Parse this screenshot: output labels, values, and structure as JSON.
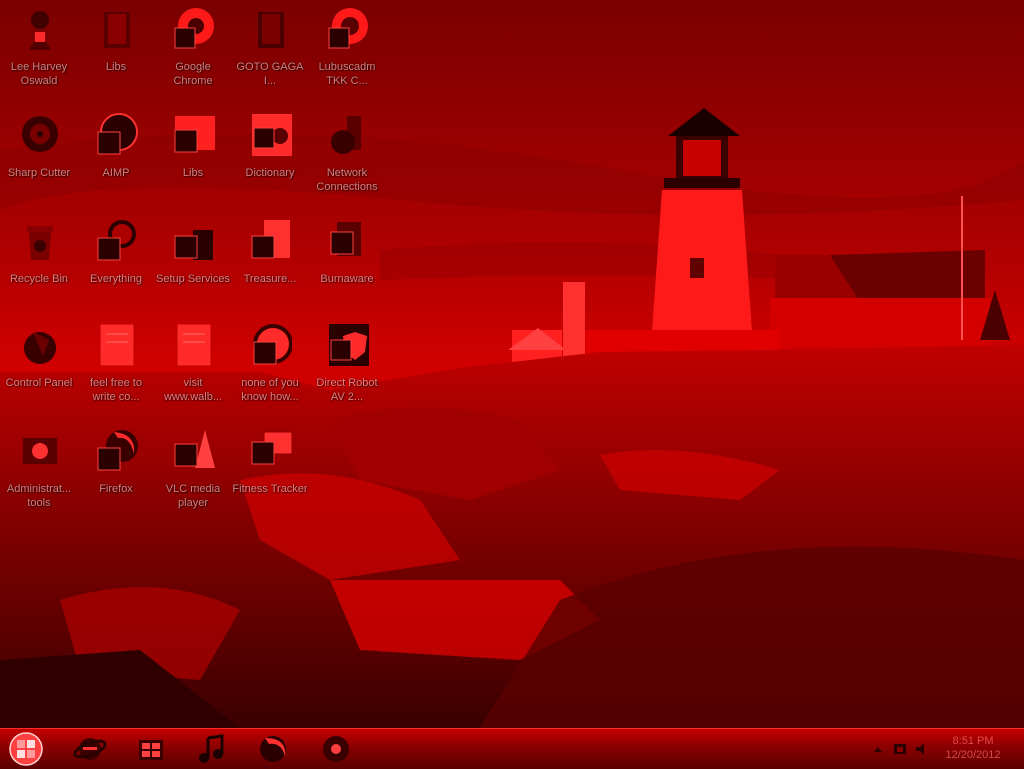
{
  "desktop": {
    "icons": [
      {
        "label": "Lee Harvey Oswald",
        "icon": "person-icon"
      },
      {
        "label": "Libs",
        "icon": "folder-icon"
      },
      {
        "label": "Google Chrome",
        "icon": "chrome-icon"
      },
      {
        "label": "GOTO GAGA I...",
        "icon": "folder-icon"
      },
      {
        "label": "Lubuscadm TKK C...",
        "icon": "shortcut-icon"
      },
      {
        "label": "Sharp Cutter",
        "icon": "disc-icon"
      },
      {
        "label": "AIMP",
        "icon": "aimp-icon"
      },
      {
        "label": "Libs",
        "icon": "media-icon"
      },
      {
        "label": "Dictionary",
        "icon": "dictionary-icon"
      },
      {
        "label": "Network Connections",
        "icon": "network-icon"
      },
      {
        "label": "Recycle Bin",
        "icon": "recycle-bin-icon"
      },
      {
        "label": "Everything",
        "icon": "search-icon"
      },
      {
        "label": "Setup Services",
        "icon": "setup-icon"
      },
      {
        "label": "Treasure...",
        "icon": "document-icon"
      },
      {
        "label": "Burnaware",
        "icon": "burn-icon"
      },
      {
        "label": "Control Panel",
        "icon": "control-panel-icon"
      },
      {
        "label": "feel free to write co...",
        "icon": "text-file-icon"
      },
      {
        "label": "visit www.walb...",
        "icon": "text-file-icon"
      },
      {
        "label": "none of you know how...",
        "icon": "text-file-icon"
      },
      {
        "label": "Direct Robot AV 2...",
        "icon": "shield-icon"
      },
      {
        "label": "Administrat... tools",
        "icon": "tools-icon"
      },
      {
        "label": "Firefox",
        "icon": "firefox-icon"
      },
      {
        "label": "VLC media player",
        "icon": "vlc-icon"
      },
      {
        "label": "Fitness Tracker",
        "icon": "app-icon"
      }
    ]
  },
  "taskbar": {
    "start": {
      "icon": "windows-orb-icon"
    },
    "pinned": [
      {
        "name": "Internet Explorer",
        "icon": "internet-explorer-icon"
      },
      {
        "name": "Windows Media Center",
        "icon": "media-center-icon"
      },
      {
        "name": "Music",
        "icon": "music-note-icon"
      },
      {
        "name": "Firefox",
        "icon": "firefox-icon"
      },
      {
        "name": "Google Chrome",
        "icon": "chrome-icon"
      }
    ],
    "tray": {
      "icons": [
        "show-hidden-icons-icon",
        "network-tray-icon",
        "volume-icon"
      ],
      "time": "8:51 PM",
      "date": "12/20/2012"
    }
  },
  "colors": {
    "tint": "#ff0000",
    "taskbar": "#b00000",
    "label_text": "#ffd0d0"
  }
}
